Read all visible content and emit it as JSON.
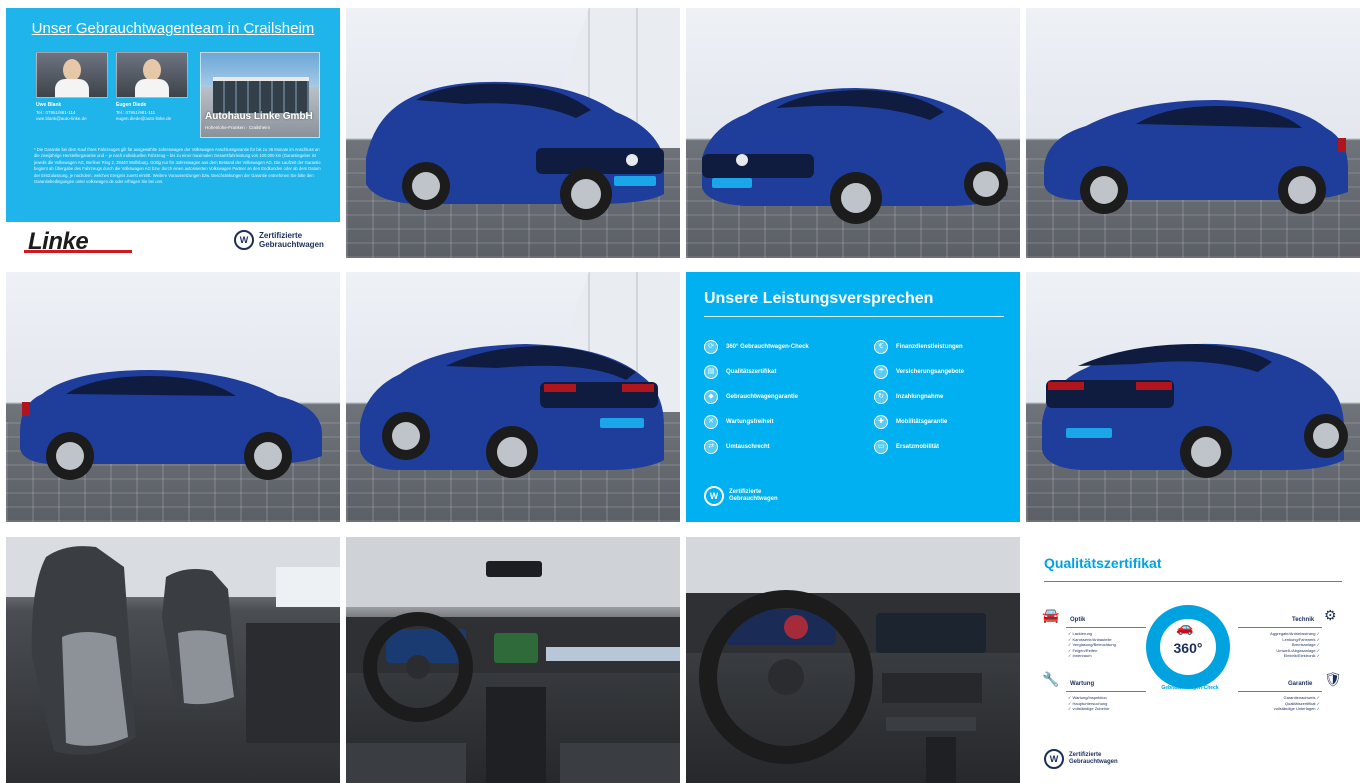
{
  "team_panel": {
    "title": "Unser Gebrauchtwagenteam in Crailsheim",
    "person1_name": "Uwe Blank",
    "person1_contact": "Tel.: 07951/981-114\nuwe.blank@auto-linke.de",
    "person2_name": "Eugen Diede",
    "person2_contact": "Tel.: 07951/981-111\neugen.diede@auto-linke.de",
    "dealer_name": "Autohaus Linke GmbH",
    "dealer_sub": "Hohenlohe-Franken · Crailsheim",
    "warranty_text": "* Die Garantie bei dem Kauf Ihres Fahrzeuges gilt für ausgewählte Jahreswagen der Volkswagen Anschlussgarantie für bis zu 36 Monate im Anschluss an die zweijährige Herstellergarantie und – je nach individuellen Fahrzeug – bis zu einer maximalen Gesamtfahrleistung von 100.000 km (Garantiegeber ist jeweils die Volkswagen AG, Berliner Ring 2, 38440 Wolfsburg. Gültig nur für Jahreswagen aus dem Bestand der Volkswagen AG. Die Laufzeit der Garantie beginnt ab Übergabe des Fahrzeugs durch die Volkswagen AG bzw. durch einen autorisierten Volkswagen Partner an den Endkunden oder ab dem Datum der Erstzulassung, je nachdem, welches Ereignis zuerst eintritt. Weitere Voraussetzungen bzw. Beschränkungen der Garantie entnehmen Sie bitte den Garantiebedingungen unter volkswagen.de oder erfragen Sie bei uns.",
    "linke_logo": "Linke",
    "vw_cert": "Zertifizierte\nGebrauchtwagen"
  },
  "promise_panel": {
    "title": "Unsere Leistungsversprechen",
    "left_items": [
      "360° Gebrauchtwagen-Check",
      "Qualitätszertifikat",
      "Gebrauchtwagengarantie",
      "Wartungsfreiheit",
      "Umtauschrecht"
    ],
    "right_items": [
      "Finanzdienstleistungen",
      "Versicherungsangebote",
      "Inzahlungnahme",
      "Mobilitätsgarantie",
      "Ersatzmobilität"
    ],
    "vw_cert": "Zertifizierte\nGebrauchtwagen"
  },
  "quality_panel": {
    "title": "Qualitätszertifikat",
    "optik_label": "Optik",
    "optik_items": [
      "✓ Lackierung",
      "✓ Karosserie/Anbauteile",
      "✓ Verglasung/Beleuchtung",
      "✓ Felgen/Reifen",
      "✓ Innenraum"
    ],
    "wartung_label": "Wartung",
    "wartung_items": [
      "✓ Wartung/Inspektion",
      "✓ Hauptuntersuchung",
      "✓ vollständige Zubehör"
    ],
    "technik_label": "Technik",
    "technik_items": [
      "Aggregate/Antriebsstrang ✓",
      "Lenkung/Fahrwerk ✓",
      "Bremsanlage ✓",
      "Umwelt-/Abgasanlage ✓",
      "Elektrik/Elektronik ✓"
    ],
    "garantie_label": "Garantie",
    "garantie_items": [
      "Garantienachweis ✓",
      "Qualitätszertifikat ✓",
      "vollständige Unterlagen ✓"
    ],
    "ring_label": "360°",
    "ring_text": "Gebrauchtwagen-Check",
    "vw_cert": "Zertifizierte\nGebrauchtwagen"
  },
  "car": {
    "body_color": "#1f3e9c",
    "body_shade": "#142a6e",
    "plate_color": "#1aa6e8"
  }
}
